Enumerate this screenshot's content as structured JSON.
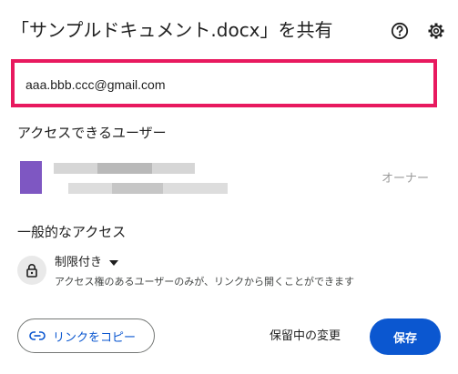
{
  "dialog": {
    "title": "「サンプルドキュメント.docx」を共有"
  },
  "icons": {
    "help": "help-circle-icon",
    "settings": "gear-icon",
    "lock": "lock-icon",
    "dropdown": "caret-down-icon",
    "link": "link-icon"
  },
  "share_input": {
    "value": "aaa.bbb.ccc@gmail.com",
    "highlight_color": "#e8195f"
  },
  "people_section": {
    "heading": "アクセスできるユーザー",
    "people": [
      {
        "avatar_color": "#7e57c2",
        "role": "オーナー"
      }
    ]
  },
  "general_access": {
    "heading": "一般的なアクセス",
    "selected": "制限付き",
    "description": "アクセス権のあるユーザーのみが、リンクから開くことができます"
  },
  "footer": {
    "copy_link_label": "リンクをコピー",
    "pending_label": "保留中の変更",
    "save_label": "保存",
    "accent_color": "#0b57d0"
  }
}
